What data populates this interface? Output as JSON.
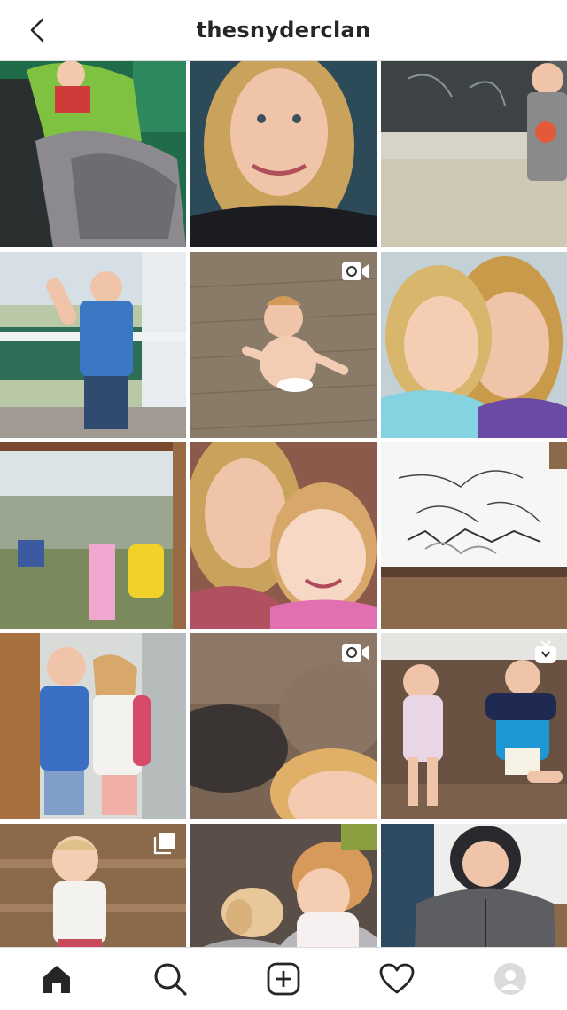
{
  "header": {
    "username": "thesnyderclan",
    "back_icon": "chevron-left-icon"
  },
  "grid": {
    "posts": [
      {
        "kind": "photo",
        "subject": "child-in-chair-blanket"
      },
      {
        "kind": "photo",
        "subject": "woman-selfie"
      },
      {
        "kind": "photo",
        "subject": "boy-at-chalkboard"
      },
      {
        "kind": "photo",
        "subject": "boy-waving-porch"
      },
      {
        "kind": "video",
        "subject": "baby-crawling-floor"
      },
      {
        "kind": "photo",
        "subject": "girl-and-mom-selfie"
      },
      {
        "kind": "photo",
        "subject": "kids-on-swingset"
      },
      {
        "kind": "photo",
        "subject": "mom-and-baby-selfie"
      },
      {
        "kind": "photo",
        "subject": "dot-to-dot-drawing"
      },
      {
        "kind": "photo",
        "subject": "boy-and-girl-hugging"
      },
      {
        "kind": "video",
        "subject": "child-on-couch"
      },
      {
        "kind": "igtv",
        "subject": "kids-on-couch-reading"
      },
      {
        "kind": "carousel",
        "subject": "toddler-on-steps"
      },
      {
        "kind": "photo",
        "subject": "girl-with-puppy"
      },
      {
        "kind": "photo",
        "subject": "boy-in-grey-hoodie"
      }
    ]
  },
  "nav": {
    "items": [
      "home-icon",
      "search-icon",
      "new-post-icon",
      "activity-heart-icon",
      "profile-avatar-icon"
    ]
  },
  "colors": {
    "accent_dark": "#262626",
    "divider": "#dbdbdb"
  }
}
